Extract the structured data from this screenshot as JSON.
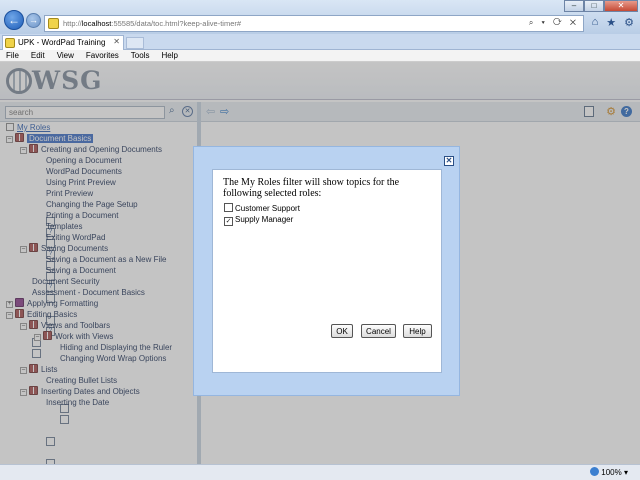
{
  "browser": {
    "url_prefix": "http://",
    "url_host": "localhost",
    "url_rest": ":55585/data/toc.html?keep-alive-timer#",
    "address_tools": "⌕ ▾ ⟳ ✕",
    "tab_title": "UPK - WordPad Training",
    "menu": [
      "File",
      "Edit",
      "View",
      "Favorites",
      "Tools",
      "Help"
    ],
    "zoom": "100%"
  },
  "app": {
    "logo": "WSG",
    "search_placeholder": "search",
    "tree": [
      {
        "label": "My Roles",
        "kind": "link"
      },
      {
        "label": "Document Basics",
        "kind": "selected"
      },
      {
        "label": "Creating and Opening Documents"
      },
      {
        "label": "Opening a Document"
      },
      {
        "label": "WordPad Documents"
      },
      {
        "label": "Using Print Preview"
      },
      {
        "label": "Print Preview"
      },
      {
        "label": "Changing the Page Setup"
      },
      {
        "label": "Printing a Document"
      },
      {
        "label": "Templates"
      },
      {
        "label": "Exiting WordPad"
      },
      {
        "label": "Saving Documents"
      },
      {
        "label": "Saving a Document as a New File"
      },
      {
        "label": "Saving a Document"
      },
      {
        "label": "Document Security"
      },
      {
        "label": "Assessment - Document Basics"
      },
      {
        "label": "Applying Formatting"
      },
      {
        "label": "Editing Basics"
      },
      {
        "label": "Views and Toolbars"
      },
      {
        "label": "Work with Views"
      },
      {
        "label": "Hiding and Displaying the Ruler"
      },
      {
        "label": "Changing Word Wrap Options"
      },
      {
        "label": "Lists"
      },
      {
        "label": "Creating Bullet Lists"
      },
      {
        "label": "Inserting Dates and Objects"
      },
      {
        "label": "Inserting the Date"
      }
    ]
  },
  "dialog": {
    "message": "The My Roles filter will show topics for the following selected roles:",
    "roles": [
      {
        "label": "Customer Support",
        "checked": false
      },
      {
        "label": "Supply Manager",
        "checked": true
      }
    ],
    "ok_label": "OK",
    "cancel_label": "Cancel",
    "help_label": "Help",
    "close_glyph": "✕"
  }
}
